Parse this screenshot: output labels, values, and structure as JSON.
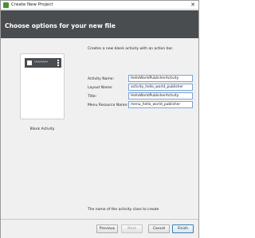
{
  "window": {
    "title": "Create New Project",
    "close_glyph": "✕",
    "app_icon": "android-studio-icon"
  },
  "header": {
    "title": "Choose options for your new file"
  },
  "template": {
    "description": "Creates a new blank activity with an action bar.",
    "preview_caption": "Blank Activity",
    "preview_wave_glyph": "〰〰〰"
  },
  "fields": {
    "activity_name": {
      "label": "Activity Name:",
      "value": "HelloWorldPublisherActivity"
    },
    "layout_name": {
      "label": "Layout Name:",
      "value": "activity_hello_world_publisher"
    },
    "title": {
      "label": "Title:",
      "value": "HelloWorldPublisherActivity"
    },
    "menu_resource_name": {
      "label": "Menu Resource Name:",
      "value": "menu_hello_world_publisher"
    }
  },
  "hint": "The name of the activity class to create",
  "buttons": {
    "previous": "Previous",
    "next": "Next",
    "cancel": "Cancel",
    "finish": "Finish"
  },
  "colors": {
    "header_bg": "#4a4d50",
    "input_border": "#7aa3d6",
    "primary_border": "#3c7fb1"
  }
}
